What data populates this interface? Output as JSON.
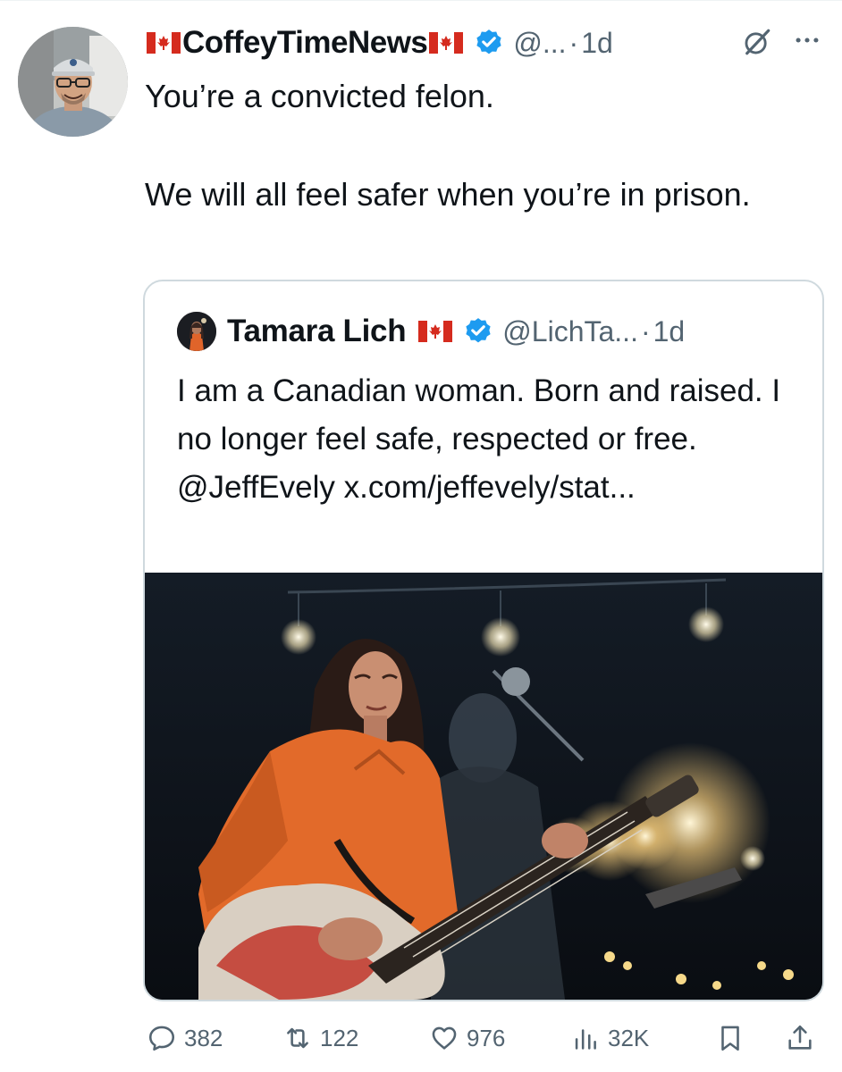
{
  "tweet": {
    "author": {
      "name": "CoffeyTimeNews",
      "handle": "@...",
      "verified": true,
      "flag_icon": "canada-flag-icon"
    },
    "time": "1d",
    "separator": "·",
    "text_lines": [
      "You’re a convicted felon.",
      "We will all feel safer when you’re in prison."
    ],
    "quoted": {
      "author": {
        "name": "Tamara Lich",
        "handle": "@LichTa...",
        "verified": true,
        "flag_icon": "canada-flag-icon"
      },
      "time": "1d",
      "separator": "·",
      "text": "I am a Canadian woman. Born and raised. I no longer feel safe, respected or free.",
      "mention": "@JeffEvely",
      "link": "x.com/jeffevely/stat..."
    },
    "stats": {
      "replies": "382",
      "reposts": "122",
      "likes": "976",
      "views": "32K"
    }
  },
  "colors": {
    "text_primary": "#0f1419",
    "text_secondary": "#536471",
    "verified_blue": "#1d9bf0",
    "border": "#cfd9de",
    "flag_red": "#d52b1e"
  },
  "icons": [
    "canada-flag-icon",
    "verified-badge-icon",
    "grok-icon",
    "more-icon",
    "reply-icon",
    "repost-icon",
    "like-icon",
    "views-icon",
    "bookmark-icon",
    "share-icon"
  ]
}
